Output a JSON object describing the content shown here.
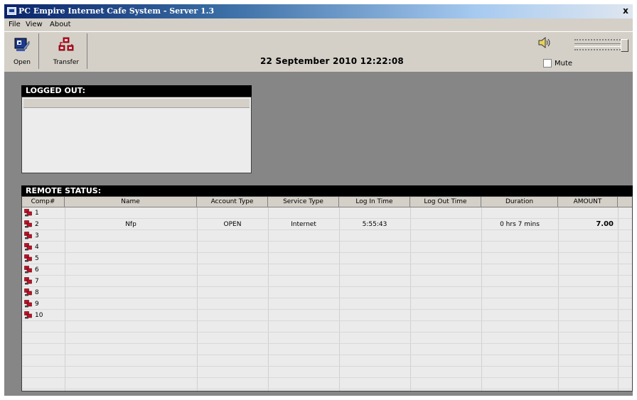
{
  "window": {
    "title": "PC Empire Internet Cafe System  - Server 1.3",
    "close_label": "x"
  },
  "menu": [
    "File",
    "View",
    "About"
  ],
  "toolbar": {
    "open_label": "Open",
    "transfer_label": "Transfer"
  },
  "datetime": "22 September 2010 12:22:08",
  "sound": {
    "mute_label": "Mute",
    "muted": false,
    "speaker_icon": "speaker-icon"
  },
  "logged_out": {
    "title": "LOGGED OUT:"
  },
  "remote_status": {
    "title": "REMOTE STATUS:",
    "columns": [
      "Comp#",
      "Name",
      "Account Type",
      "Service Type",
      "Log In Time",
      "Log Out Time",
      "Duration",
      "AMOUNT"
    ],
    "rows": [
      {
        "comp": "1",
        "name": "",
        "account_type": "",
        "service_type": "",
        "login_time": "",
        "logout_time": "",
        "duration": "",
        "amount": ""
      },
      {
        "comp": "2",
        "name": "Nfp",
        "account_type": "OPEN",
        "service_type": "Internet",
        "login_time": "5:55:43",
        "logout_time": "",
        "duration": "0 hrs 7 mins",
        "amount": "7.00"
      },
      {
        "comp": "3",
        "name": "",
        "account_type": "",
        "service_type": "",
        "login_time": "",
        "logout_time": "",
        "duration": "",
        "amount": ""
      },
      {
        "comp": "4",
        "name": "",
        "account_type": "",
        "service_type": "",
        "login_time": "",
        "logout_time": "",
        "duration": "",
        "amount": ""
      },
      {
        "comp": "5",
        "name": "",
        "account_type": "",
        "service_type": "",
        "login_time": "",
        "logout_time": "",
        "duration": "",
        "amount": ""
      },
      {
        "comp": "6",
        "name": "",
        "account_type": "",
        "service_type": "",
        "login_time": "",
        "logout_time": "",
        "duration": "",
        "amount": ""
      },
      {
        "comp": "7",
        "name": "",
        "account_type": "",
        "service_type": "",
        "login_time": "",
        "logout_time": "",
        "duration": "",
        "amount": ""
      },
      {
        "comp": "8",
        "name": "",
        "account_type": "",
        "service_type": "",
        "login_time": "",
        "logout_time": "",
        "duration": "",
        "amount": ""
      },
      {
        "comp": "9",
        "name": "",
        "account_type": "",
        "service_type": "",
        "login_time": "",
        "logout_time": "",
        "duration": "",
        "amount": ""
      },
      {
        "comp": "10",
        "name": "",
        "account_type": "",
        "service_type": "",
        "login_time": "",
        "logout_time": "",
        "duration": "",
        "amount": ""
      }
    ]
  },
  "colors": {
    "title_bar": "#0a246a",
    "client_bg": "#868686",
    "panel_header": "#000000",
    "pc_icon": "#c0102a"
  }
}
